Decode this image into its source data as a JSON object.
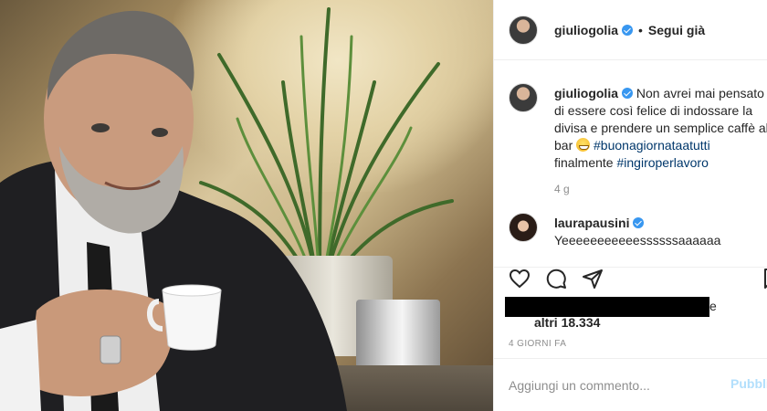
{
  "post": {
    "username": "giuliogolia",
    "follow_status": "Segui già",
    "separator": "•"
  },
  "caption": {
    "username": "giuliogolia",
    "text_1": "Non avrei mai pensato di essere così felice di indossare la divisa e prendere un semplice caffè al bar",
    "hashtag_1": "#buonagiornataatutti",
    "text_2": "finalmente",
    "hashtag_2": "#ingiroperlavoro",
    "time": "4 g"
  },
  "comment": {
    "username": "laurapausini",
    "text": "Yeeeeeeeeeeessssssaaaaaa"
  },
  "likes": {
    "redacted_tail": "e",
    "others": "altri 18.334"
  },
  "posted_ago": "4 GIORNI FA",
  "add_comment": {
    "placeholder": "Aggiungi un commento...",
    "publish": "Pubblica"
  },
  "colors": {
    "verified": "#3897f0",
    "hashtag": "#00376b",
    "muted": "#8e8e8e",
    "publish_disabled": "#b2dffc"
  },
  "icons": [
    "verified-badge-icon",
    "heart-icon",
    "comment-icon",
    "share-icon",
    "bookmark-icon",
    "emoji-grin-icon"
  ]
}
